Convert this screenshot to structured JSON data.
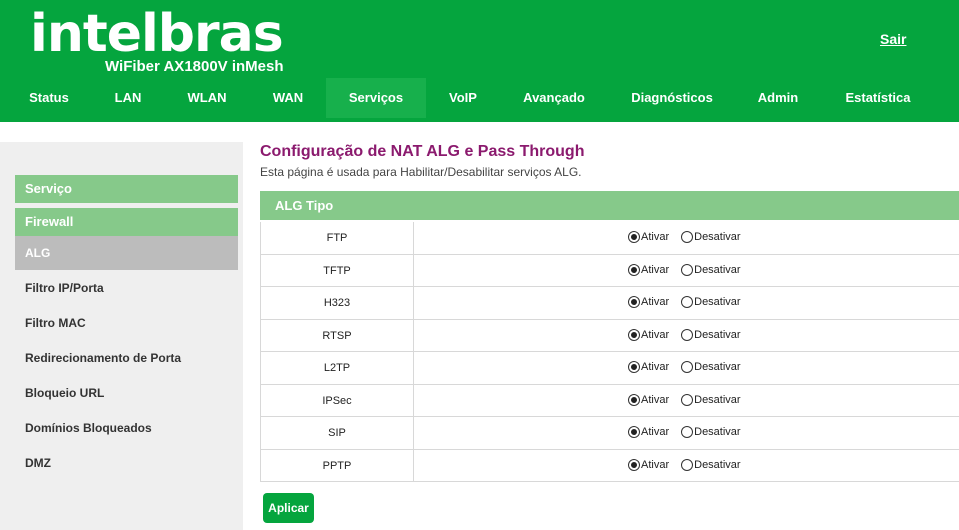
{
  "header": {
    "logo": "intelbras",
    "model": "WiFiber AX1800V inMesh",
    "logout": "Sair",
    "nav": [
      "Status",
      "LAN",
      "WLAN",
      "WAN",
      "Serviços",
      "VoIP",
      "Avançado",
      "Diagnósticos",
      "Admin",
      "Estatística"
    ],
    "active_nav": "Serviços"
  },
  "sidebar": {
    "sections": [
      "Serviço",
      "Firewall"
    ],
    "items": [
      "ALG",
      "Filtro IP/Porta",
      "Filtro MAC",
      "Redirecionamento de Porta",
      "Bloqueio URL",
      "Domínios Bloqueados",
      "DMZ"
    ],
    "active_item": "ALG"
  },
  "main": {
    "title": "Configuração de NAT ALG e Pass Through",
    "description": "Esta página é usada para Habilitar/Desabilitar serviços ALG.",
    "table_header": "ALG Tipo",
    "option_on": "Ativar",
    "option_off": "Desativar",
    "rows": [
      {
        "name": "FTP",
        "enabled": true
      },
      {
        "name": "TFTP",
        "enabled": true
      },
      {
        "name": "H323",
        "enabled": true
      },
      {
        "name": "RTSP",
        "enabled": true
      },
      {
        "name": "L2TP",
        "enabled": true
      },
      {
        "name": "IPSec",
        "enabled": true
      },
      {
        "name": "SIP",
        "enabled": true
      },
      {
        "name": "PPTP",
        "enabled": true
      }
    ],
    "apply_label": "Aplicar"
  },
  "colors": {
    "brand_green": "#05a53e",
    "section_green": "#86c98a",
    "title_purple": "#8b1a6e"
  }
}
